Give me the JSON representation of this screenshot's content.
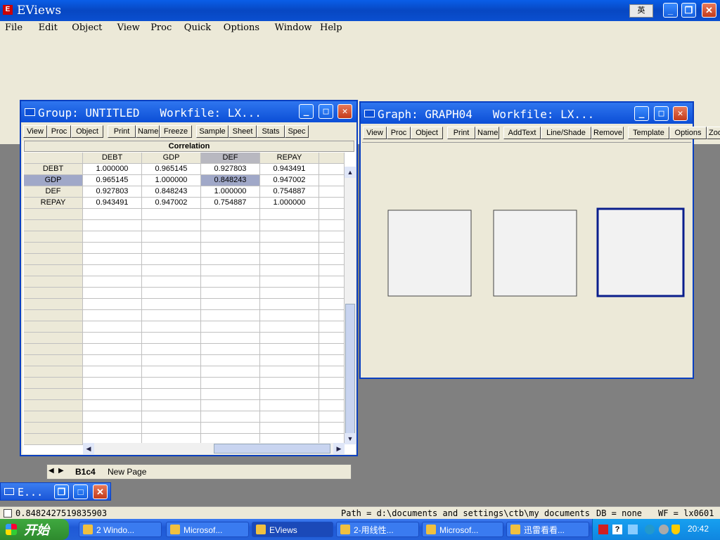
{
  "app": {
    "title": "EViews"
  },
  "menu": [
    "File",
    "Edit",
    "Object",
    "View",
    "Proc",
    "Quick",
    "Options",
    "Window",
    "Help"
  ],
  "ime_indicator": "英",
  "group_window": {
    "title": "Group: UNTITLED   Workfile: LX...",
    "toolbar": [
      "View",
      "Proc",
      "Object",
      "Print",
      "Name",
      "Freeze",
      "Sample",
      "Sheet",
      "Stats",
      "Spec"
    ],
    "table_title": "Correlation",
    "columns": [
      "DEBT",
      "GDP",
      "DEF",
      "REPAY"
    ],
    "rows": [
      {
        "label": "DEBT",
        "values": [
          "1.000000",
          "0.965145",
          "0.927803",
          "0.943491"
        ]
      },
      {
        "label": "GDP",
        "values": [
          "0.965145",
          "1.000000",
          "0.848243",
          "0.947002"
        ]
      },
      {
        "label": "DEF",
        "values": [
          "0.927803",
          "0.848243",
          "1.000000",
          "0.754887"
        ]
      },
      {
        "label": "REPAY",
        "values": [
          "0.943491",
          "0.947002",
          "0.754887",
          "1.000000"
        ]
      }
    ],
    "selected_cell": "GDP/DEF",
    "tabs": [
      "B1c4",
      "New Page"
    ]
  },
  "graph_window": {
    "title": "Graph: GRAPH04   Workfile: LX...",
    "toolbar": [
      "View",
      "Proc",
      "Object",
      "Print",
      "Name",
      "AddText",
      "Line/Shade",
      "Remove",
      "Template",
      "Options",
      "Zoom"
    ]
  },
  "minimized_window": {
    "title": "E..."
  },
  "status": {
    "value": "0.8482427519835903",
    "path": "Path = d:\\documents and settings\\ctb\\my documents",
    "db": "DB = none",
    "wf": "WF = lx0601"
  },
  "taskbar": {
    "start_label": "开始",
    "items": [
      "2 Windo...",
      "Microsof...",
      "EViews",
      "2-用线性...",
      "Microsof...",
      "迅雷看看..."
    ],
    "clock": "20:42"
  },
  "chart_data": [
    {
      "type": "scatter",
      "title": "",
      "xlabel": "",
      "ylabel": "",
      "xlim": [
        0,
        5000
      ],
      "ylim": [
        0,
        1000
      ],
      "x": [],
      "y": []
    },
    {
      "type": "scatter",
      "title": "",
      "xlabel": "",
      "ylabel": "",
      "xlim": [
        0,
        5000
      ],
      "ylim": [
        -500,
        3000
      ],
      "x": [],
      "y": []
    },
    {
      "type": "scatter",
      "title": "",
      "xlabel": "",
      "ylabel": "",
      "xlim": [
        0,
        5000
      ],
      "ylim": [
        0,
        2400
      ],
      "x": [],
      "y": []
    }
  ],
  "colors": {
    "titlebar": "#0b4ed6",
    "selection": "#a0a8c8",
    "plot_marker": "#1010c0"
  }
}
